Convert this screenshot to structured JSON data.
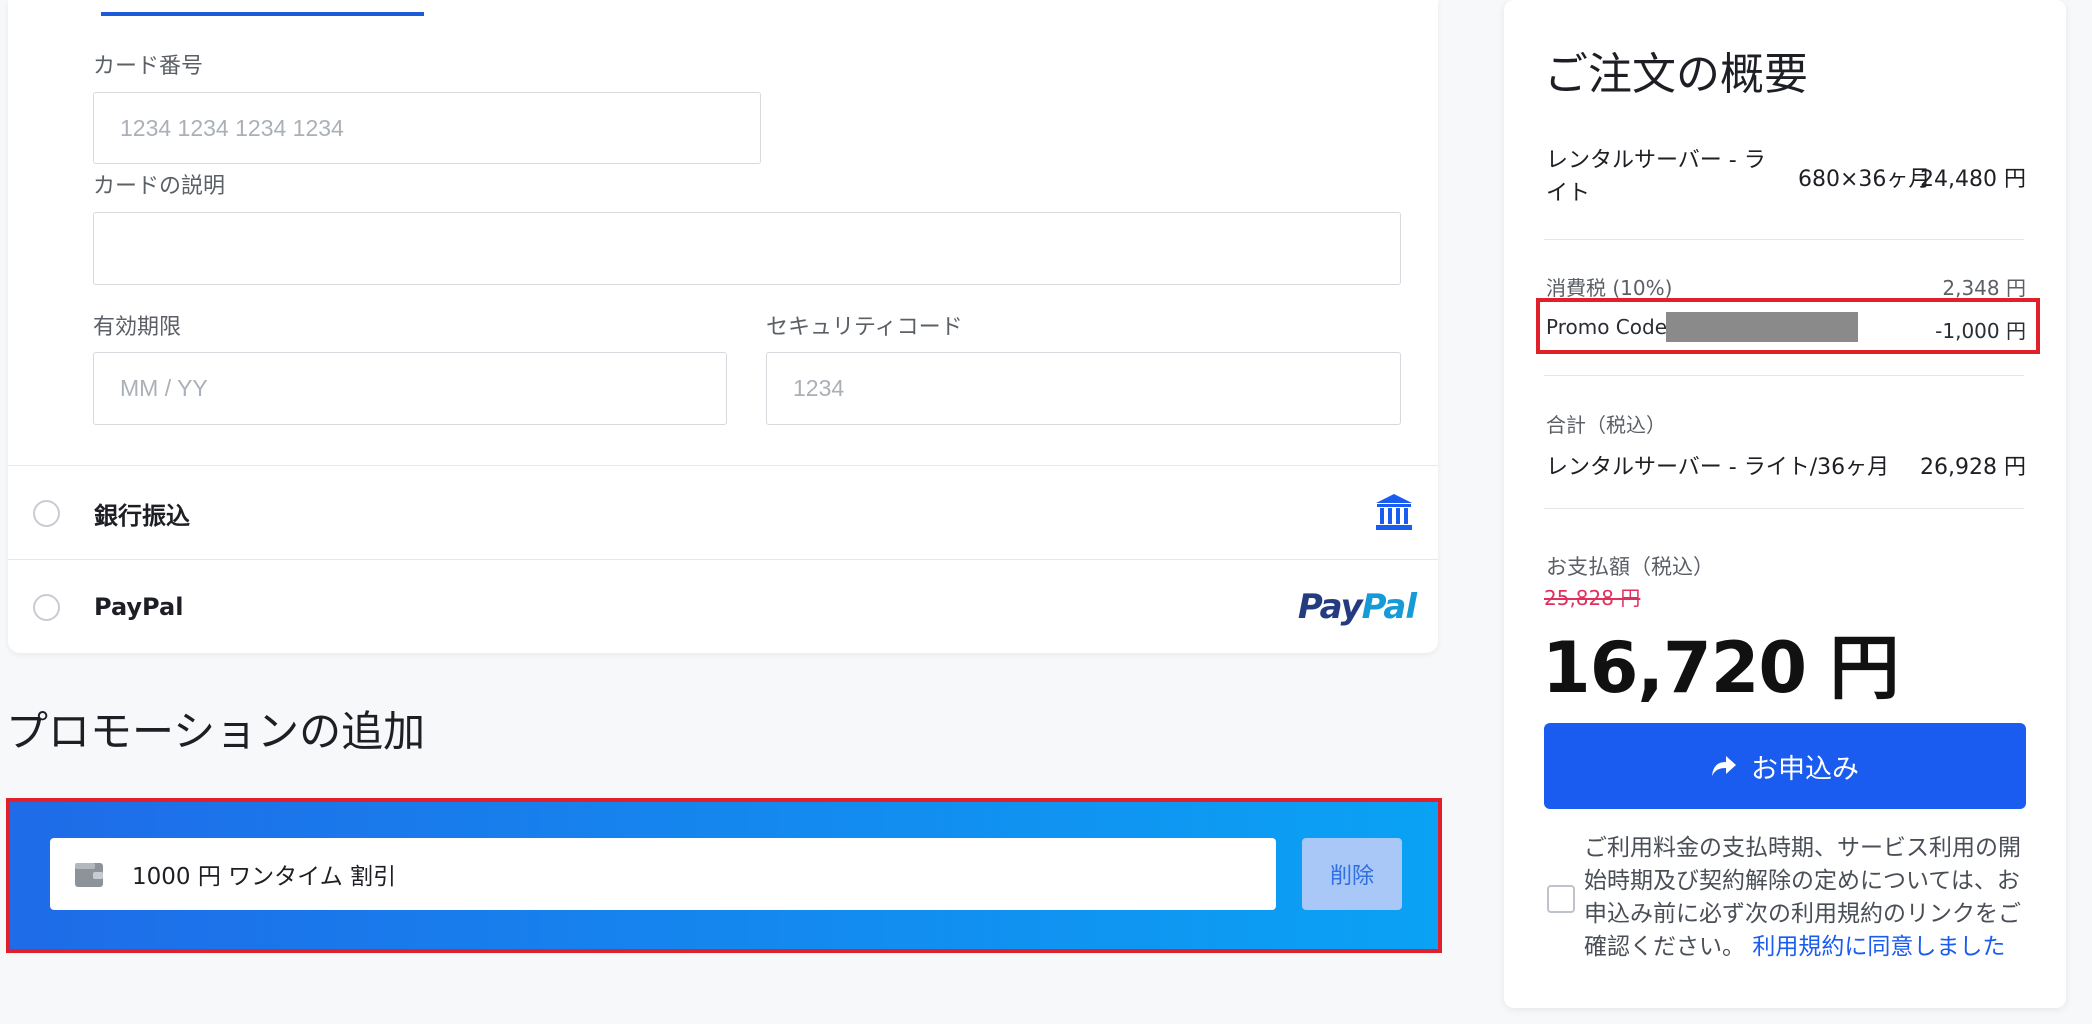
{
  "card_form": {
    "card_number_label": "カード番号",
    "card_number_placeholder": "1234 1234 1234 1234",
    "card_description_label": "カードの説明",
    "card_description_value": "",
    "expiry_label": "有効期限",
    "expiry_placeholder": "MM / YY",
    "cvc_label": "セキュリティコード",
    "cvc_placeholder": "1234"
  },
  "payment_options": [
    {
      "label": "銀行振込",
      "icon": "bank-icon"
    },
    {
      "label": "PayPal",
      "icon": "paypal-logo",
      "logo_a": "Pay",
      "logo_b": "Pal"
    }
  ],
  "promotion": {
    "heading": "プロモーションの追加",
    "applied_code": "1000 円 ワンタイム 割引",
    "delete_label": "削除"
  },
  "summary": {
    "title": "ご注文の概要",
    "item_name_line1": "レンタルサーバー - ラ",
    "item_name_line2": "イト",
    "item_qty": "680×36ヶ月",
    "item_price": "24,480 円",
    "tax_label": "消費税 (10%)",
    "tax_value": "2,348 円",
    "promo_label": "Promo Code:",
    "promo_value": "-1,000 円",
    "total_label": "合計（税込）",
    "total_item": "レンタルサーバー - ライト/36ヶ月",
    "total_value": "26,928 円",
    "pay_label": "お支払額（税込）",
    "original_price": "25,828 円",
    "final_price": "16,720 円",
    "apply_button": "お申込み",
    "terms_text": "ご利用料金の支払時期、サービス利用の開始時期及び契約解除の定めについては、お申込み前に必ず次の利用規約のリンクをご確認ください。",
    "terms_link": "利用規約に同意しました"
  },
  "colors": {
    "accent": "#1a5cf0",
    "highlight_border": "#e0202a",
    "strike_price": "#e0305e"
  }
}
